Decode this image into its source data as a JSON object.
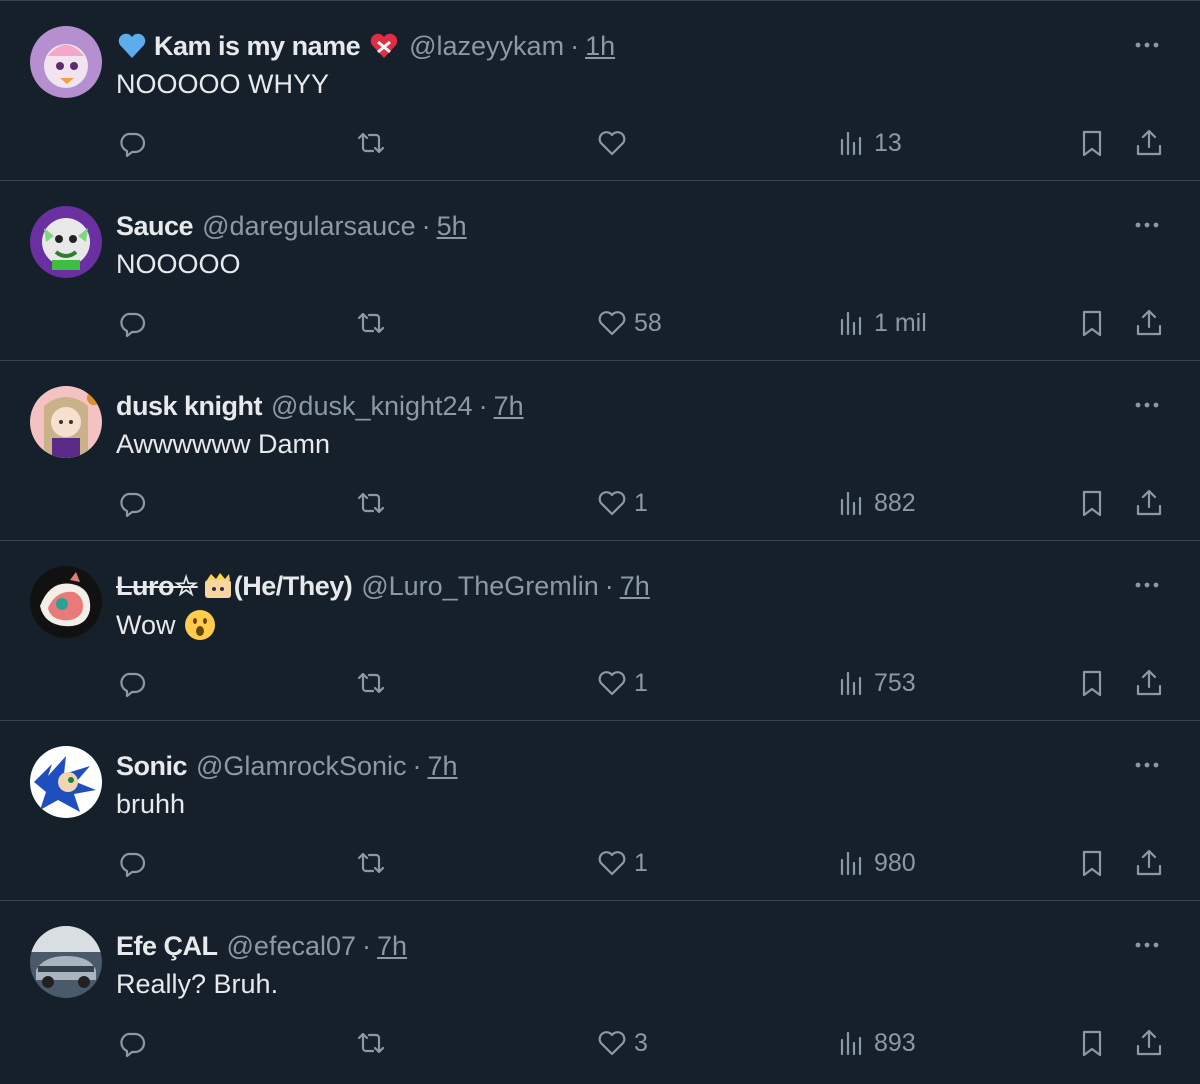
{
  "replies": [
    {
      "name": "Kam is my name",
      "name_prefix_emoji": "blue-heart-emoji",
      "name_suffix_emoji": "mending-heart-emoji",
      "handle": "@lazeyykam",
      "separator": "·",
      "time": "1h",
      "text": "NOOOOO WHYY",
      "likes": "",
      "views": "13"
    },
    {
      "name": "Sauce",
      "handle": "@daregularsauce",
      "separator": "·",
      "time": "5h",
      "text": "NOOOOO",
      "likes": "58",
      "views": "1 mil"
    },
    {
      "name": "dusk knight",
      "handle": "@dusk_knight24",
      "separator": "·",
      "time": "7h",
      "text": "Awwwwww Damn",
      "likes": "1",
      "views": "882"
    },
    {
      "name": "Luro☆",
      "name_suffix_emoji": "crown-hat-emoji",
      "name_suffix": "(He/They)",
      "handle": "@Luro_TheGremlin",
      "separator": "·",
      "time": "7h",
      "text": "Wow",
      "text_emoji": "astonished-face-emoji",
      "likes": "1",
      "views": "753"
    },
    {
      "name": "Sonic",
      "handle": "@GlamrockSonic",
      "separator": "·",
      "time": "7h",
      "text": "bruhh",
      "likes": "1",
      "views": "980"
    },
    {
      "name": "Efe ÇAL",
      "handle": "@efecal07",
      "separator": "·",
      "time": "7h",
      "text": "Really? Bruh.",
      "likes": "3",
      "views": "893"
    }
  ],
  "colors": {
    "background": "#15202b",
    "divider": "#38444d",
    "primary_text": "#e7e9ea",
    "secondary_text": "#8b98a5"
  },
  "icons": [
    "reply-icon",
    "retweet-icon",
    "like-icon",
    "views-icon",
    "bookmark-icon",
    "share-icon",
    "more-icon"
  ]
}
